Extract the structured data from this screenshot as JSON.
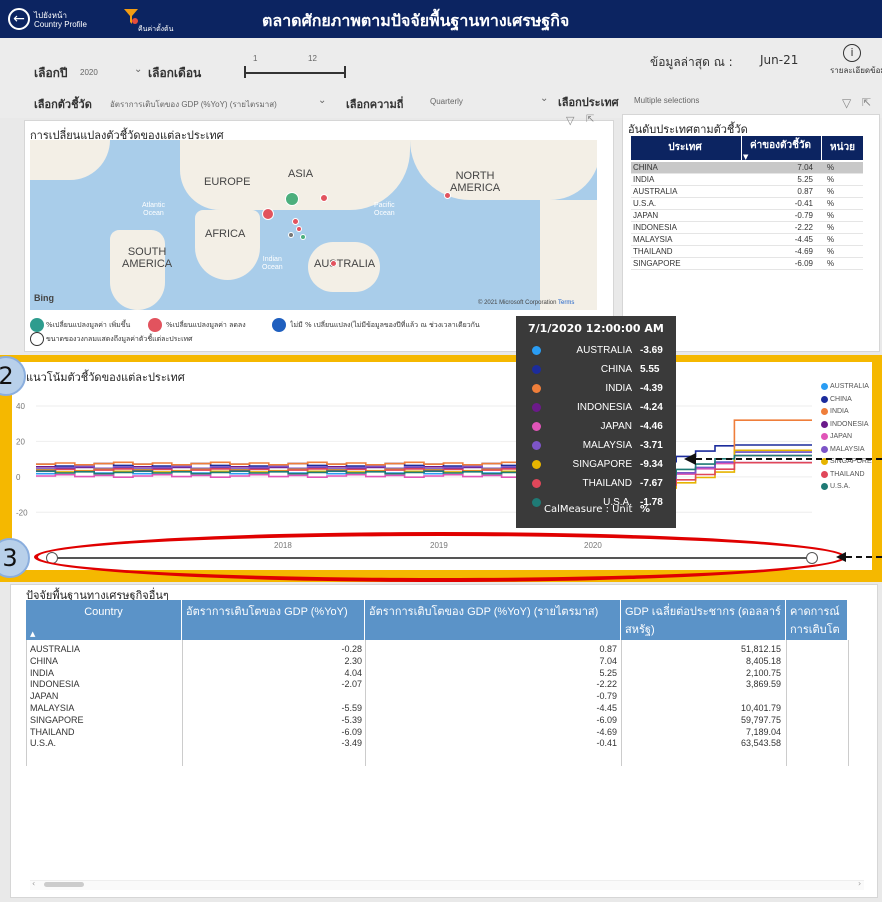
{
  "header": {
    "back_label_line1": "ไปยังหน้า",
    "back_label_line2": "Country Profile",
    "reset_label": "คืนค่าตั้งต้น",
    "title": "ตลาดศักยภาพตามปัจจัยพื้นฐานทางเศรษฐกิจ"
  },
  "filters": {
    "year_label": "เลือกปี",
    "year_value": "2020",
    "month_label": "เลือกเดือน",
    "month_min": "1",
    "month_max": "12",
    "latest_label": "ข้อมูลล่าสุด ณ :",
    "latest_value": "Jun-21",
    "detail_label": "รายละเอียดข้อมูล",
    "indicator_label": "เลือกตัวชี้วัด",
    "indicator_value": "อัตราการเติบโตของ GDP (%YoY) (รายไตรมาส)",
    "freq_label": "เลือกความถี่",
    "freq_value": "Quarterly",
    "country_label": "เลือกประเทศ",
    "country_value": "Multiple selections"
  },
  "map_panel": {
    "title": "การเปลี่ยนแปลงตัวชี้วัดของแต่ละประเทศ",
    "labels": {
      "europe": "EUROPE",
      "asia": "ASIA",
      "north_america_1": "NORTH",
      "north_america_2": "AMERICA",
      "africa": "AFRICA",
      "south_america_1": "SOUTH",
      "south_america_2": "AMERICA",
      "australia": "AUSTRALIA",
      "atlantic_1": "Atlantic",
      "atlantic_2": "Ocean",
      "pacific_1": "Pacific",
      "pacific_2": "Ocean",
      "indian_1": "Indian",
      "indian_2": "Ocean"
    },
    "bing": "Bing",
    "copyright": "© 2021 Microsoft Corporation",
    "terms": "Terms",
    "legend_increase": "%เปลี่ยนแปลงมูลค่า เพิ่มขึ้น",
    "legend_decrease": "%เปลี่ยนแปลงมูลค่า ลดลง",
    "legend_none": "ไม่มี % เปลี่ยนแปลง(ไม่มีข้อมูลของปีที่แล้ว ณ ช่วงเวลาเดียวกัน",
    "legend_size": "ขนาดของวงกลมแสดงถึงมูลค่าตัวชี้แต่ละประเทศ",
    "colors": {
      "increase": "#2e9c8e",
      "decrease": "#e2535e",
      "none": "#1f5fbf"
    }
  },
  "ranking": {
    "title": "อันดับประเทศตามตัวชี้วัด",
    "col_country": "ประเทศ",
    "col_value": "ค่าของตัวชี้วัด",
    "col_unit": "หน่วย",
    "rows": [
      {
        "country": "CHINA",
        "value": "7.04",
        "unit": "%"
      },
      {
        "country": "INDIA",
        "value": "5.25",
        "unit": "%"
      },
      {
        "country": "AUSTRALIA",
        "value": "0.87",
        "unit": "%"
      },
      {
        "country": "U.S.A.",
        "value": "-0.41",
        "unit": "%"
      },
      {
        "country": "JAPAN",
        "value": "-0.79",
        "unit": "%"
      },
      {
        "country": "INDONESIA",
        "value": "-2.22",
        "unit": "%"
      },
      {
        "country": "MALAYSIA",
        "value": "-4.45",
        "unit": "%"
      },
      {
        "country": "THAILAND",
        "value": "-4.69",
        "unit": "%"
      },
      {
        "country": "SINGAPORE",
        "value": "-6.09",
        "unit": "%"
      }
    ]
  },
  "trend_panel": {
    "title": "แนวโน้มตัวชี้วัดของแต่ละประเทศ",
    "callout_2": "2",
    "callout_3": "3",
    "y_ticks": [
      "40",
      "20",
      "0",
      "-20"
    ],
    "x_ticks": [
      "2018",
      "2019",
      "2020"
    ],
    "legend": [
      {
        "name": "AUSTRALIA",
        "color": "#2a9df4"
      },
      {
        "name": "CHINA",
        "color": "#1c2c9c"
      },
      {
        "name": "INDIA",
        "color": "#ef7e3a"
      },
      {
        "name": "INDONESIA",
        "color": "#6b1a8a"
      },
      {
        "name": "JAPAN",
        "color": "#e055b8"
      },
      {
        "name": "MALAYSIA",
        "color": "#7d55c7"
      },
      {
        "name": "SINGAPORE",
        "color": "#e6b400"
      },
      {
        "name": "THAILAND",
        "color": "#e0475a"
      },
      {
        "name": "U.S.A.",
        "color": "#1f7a75"
      }
    ]
  },
  "tooltip": {
    "date": "7/1/2020 12:00:00 AM",
    "rows": [
      {
        "name": "AUSTRALIA",
        "value": "-3.69",
        "color": "#2a9df4"
      },
      {
        "name": "CHINA",
        "value": "5.55",
        "color": "#1c2c9c"
      },
      {
        "name": "INDIA",
        "value": "-4.39",
        "color": "#ef7e3a"
      },
      {
        "name": "INDONESIA",
        "value": "-4.24",
        "color": "#6b1a8a"
      },
      {
        "name": "JAPAN",
        "value": "-4.46",
        "color": "#e055b8"
      },
      {
        "name": "MALAYSIA",
        "value": "-3.71",
        "color": "#7d55c7"
      },
      {
        "name": "SINGAPORE",
        "value": "-9.34",
        "color": "#e6b400"
      },
      {
        "name": "THAILAND",
        "value": "-7.67",
        "color": "#e0475a"
      },
      {
        "name": "U.S.A.",
        "value": "-1.78",
        "color": "#1f7a75"
      }
    ],
    "measure_label": "CalMeasure : Unit",
    "measure_value": "%"
  },
  "other_panel": {
    "title": "ปัจจัยพื้นฐานทางเศรษฐกิจอื่นๆ",
    "headers": [
      "Country",
      "อัตราการเติบโตของ GDP (%YoY)",
      "อัตราการเติบโตของ GDP (%YoY) (รายไตรมาส)",
      "GDP เฉลี่ยต่อประชากร (ดอลลาร์ สหรัฐ)",
      "คาดการณ์การเติบโต ปีถัดไป (%YoY)"
    ],
    "rows": [
      {
        "country": "AUSTRALIA",
        "gdp": "-0.28",
        "gdp_q": "0.87",
        "gdp_pc": "51,812.15"
      },
      {
        "country": "CHINA",
        "gdp": "2.30",
        "gdp_q": "7.04",
        "gdp_pc": "8,405.18"
      },
      {
        "country": "INDIA",
        "gdp": "4.04",
        "gdp_q": "5.25",
        "gdp_pc": "2,100.75"
      },
      {
        "country": "INDONESIA",
        "gdp": "-2.07",
        "gdp_q": "-2.22",
        "gdp_pc": "3,869.59"
      },
      {
        "country": "JAPAN",
        "gdp": "",
        "gdp_q": "-0.79",
        "gdp_pc": ""
      },
      {
        "country": "MALAYSIA",
        "gdp": "-5.59",
        "gdp_q": "-4.45",
        "gdp_pc": "10,401.79"
      },
      {
        "country": "SINGAPORE",
        "gdp": "-5.39",
        "gdp_q": "-6.09",
        "gdp_pc": "59,797.75"
      },
      {
        "country": "THAILAND",
        "gdp": "-6.09",
        "gdp_q": "-4.69",
        "gdp_pc": "7,189.04"
      },
      {
        "country": "U.S.A.",
        "gdp": "-3.49",
        "gdp_q": "-0.41",
        "gdp_pc": "63,543.58"
      }
    ]
  }
}
